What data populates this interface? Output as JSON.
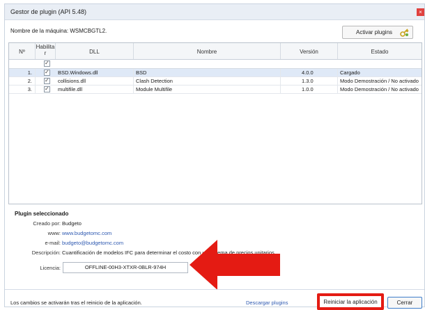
{
  "window": {
    "title": "Gestor de plugin (API 5.48)",
    "close_label": "×"
  },
  "machine_label": "Nombre de la máquina: WSMCBGTL2.",
  "activate_button": "Activar plugins",
  "table": {
    "headers": {
      "num": "Nº",
      "enabled": "Habilita r",
      "dll": "DLL",
      "name": "Nombre",
      "version": "Versión",
      "state": "Estado"
    },
    "rows": [
      {
        "num": "1.",
        "dll": "BSD.Windows.dll",
        "name": "BSD",
        "version": "4.0.0",
        "state": "Cargado"
      },
      {
        "num": "2.",
        "dll": "collisions.dll",
        "name": "Clash Detection",
        "version": "1.3.0",
        "state": "Modo Demostración / No activado"
      },
      {
        "num": "3.",
        "dll": "multifile.dll",
        "name": "Module Multifile",
        "version": "1.0.0",
        "state": "Modo Demostración / No activado"
      }
    ]
  },
  "selected": {
    "title": "Plugin seleccionado",
    "created_label": "Creado por:",
    "created": "Budgeto",
    "www_label": "www:",
    "www": "www.budgetomc.com",
    "email_label": "e-mail:",
    "email": "budgeto@budgetomc.com",
    "desc_label": "Descripción:",
    "desc": "Cuantificación de modelos IFC para determinar el costo con un sistema de precios unitarios",
    "license_label": "Licencia:",
    "license": "OFFLINE-00H3-XTXR-0BLR-974H"
  },
  "footer": {
    "note": "Los cambios se activarán tras el reinicio de la aplicación.",
    "download": "Descargar plugins",
    "restart": "Reiniciar la aplicación",
    "cancel": "Cerrar"
  },
  "colors": {
    "annotation_red": "#e41b13",
    "selection": "#dfe9f7",
    "link": "#2d58b0"
  }
}
